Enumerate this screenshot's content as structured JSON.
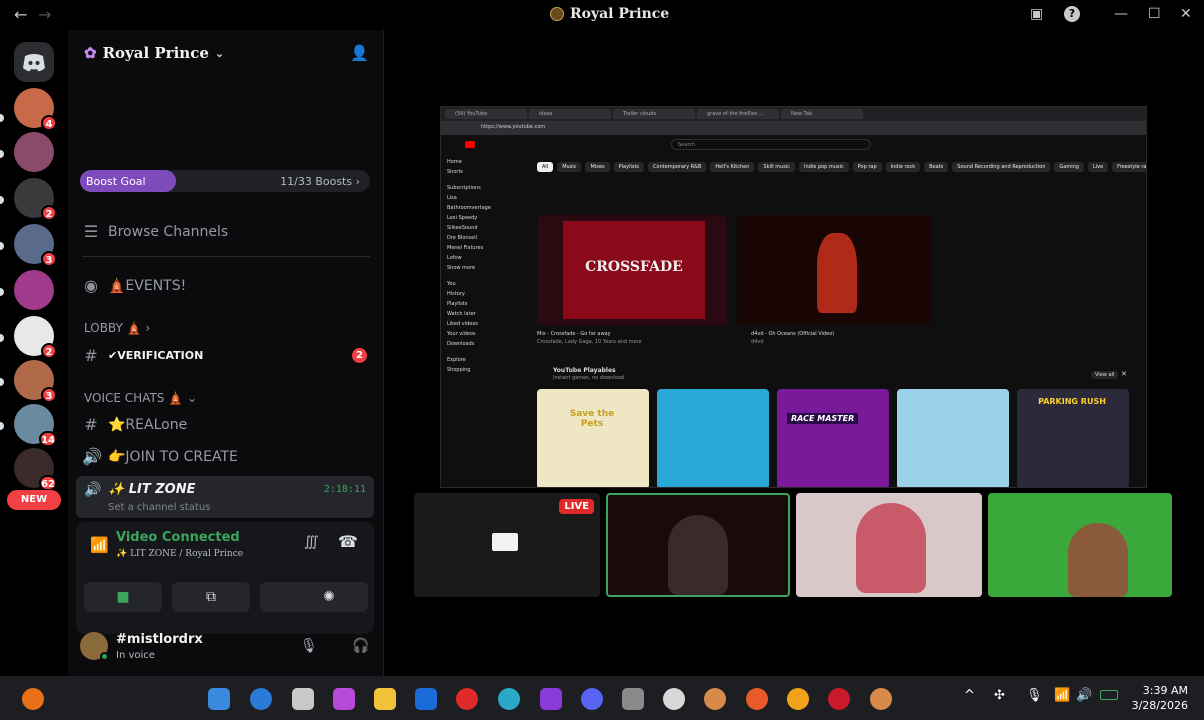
{
  "window": {
    "title": "Royal Prince",
    "emblem": "lion-emblem-icon"
  },
  "guilds": {
    "badges": [
      "4",
      "2",
      "3",
      "2",
      "3",
      "14",
      "62"
    ],
    "new_label": "NEW"
  },
  "server": {
    "name": "Royal Prince",
    "boost_label": "Boost Goal",
    "boost_count": "11/33 Boosts ›",
    "boost_progress": 0.33
  },
  "channels": {
    "browse": "Browse Channels",
    "events": "🛕EVENTS!",
    "lobby_cat": "LOBBY 🛕 ›",
    "verification": "✔VERIFICATION",
    "verification_mentions": "2",
    "voice_cat": "VOICE CHATS 🛕 ⌄",
    "realone": "⭐REALone",
    "join_create": "👉JOIN TO CREATE",
    "lit_zone": "✨ LIT ZONE",
    "lit_zone_time": "2:18:11",
    "channel_status": "Set a channel status"
  },
  "voice": {
    "status": "Video Connected",
    "location": "✨ LIT ZONE / Royal Prince"
  },
  "user": {
    "name": "#mistlordrx",
    "status": "In voice"
  },
  "stream": {
    "live_label": "LIVE",
    "browser_tabs": [
      "(59) YouTube",
      "ideas",
      "Trailer clouds",
      "grave of the fireflies ...",
      "New Tab"
    ],
    "url": "https://www.youtube.com",
    "search_placeholder": "Search",
    "chips": [
      "All",
      "Music",
      "Mixes",
      "Playlists",
      "Contemporary R&B",
      "Hell's Kitchen",
      "Skill music",
      "Indie pop music",
      "Pop rap",
      "Indie rock",
      "Beats",
      "Sound Recording and Reproduction",
      "Gaming",
      "Live",
      "Freestyle rap"
    ],
    "sidebar": [
      "Home",
      "Shorts",
      "Subscriptions",
      "Lisa",
      "Bathroomvertage",
      "Lexi Speedy",
      "SilkeeSound",
      "Dre Blonsell",
      "Menel Fixtures",
      "Lofow",
      "Show more",
      "You",
      "History",
      "Playlists",
      "Watch later",
      "Liked videos",
      "Your videos",
      "Downloads",
      "Explore",
      "Shopping"
    ],
    "video1_title": "Mix - Crossfade - Go far away",
    "video1_sub": "Crossfade, Lady Gaga, 10 Years and more",
    "video1_logo": "CROSSFADE",
    "video2_title": "d4vd - Oh Oceans (Official Video)",
    "video2_sub": "d4vd",
    "playables_title": "YouTube Playables",
    "playables_sub": "Instant games, no download",
    "view_all": "View all",
    "games": [
      "Save the Pets",
      "",
      "RACE MASTER",
      "",
      "PARKING RUSH"
    ]
  },
  "taskbar": {
    "time": "3:39 AM",
    "date": "3/28/2026"
  }
}
